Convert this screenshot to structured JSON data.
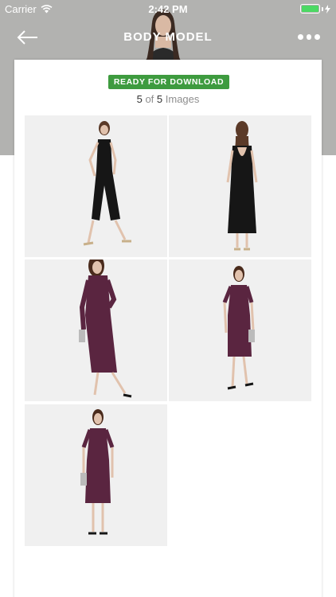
{
  "status_bar": {
    "carrier": "Carrier",
    "time": "2:42 PM",
    "battery_color": "#4cd964"
  },
  "nav": {
    "title": "BODY MODEL",
    "back_icon": "arrow-left-icon",
    "more_icon": "more-horizontal-icon"
  },
  "card": {
    "badge": "READY FOR DOWNLOAD",
    "count_current": "5",
    "count_of": "of",
    "count_total": "5",
    "count_unit": "Images"
  },
  "images": [
    {
      "outfit": "black jumpsuit, front"
    },
    {
      "outfit": "black jumpsuit, back"
    },
    {
      "outfit": "burgundy lace dress, walking"
    },
    {
      "outfit": "burgundy lace dress, standing"
    },
    {
      "outfit": "burgundy lace dress, front"
    }
  ],
  "colors": {
    "header_bg": "#b2b2b0",
    "badge_bg": "#3e9b3f",
    "jumpsuit": "#161616",
    "dress": "#5a2540",
    "photo_bg": "#f0f0f0"
  }
}
